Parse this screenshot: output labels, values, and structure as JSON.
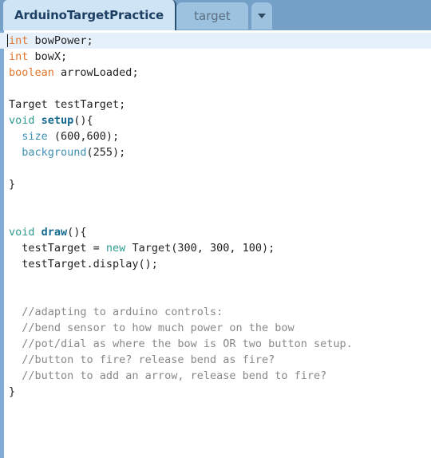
{
  "window": {
    "title": "ArduinoTargetPractice"
  },
  "tabbar": {
    "active_tab": "ArduinoTargetPractice",
    "inactive_tab": "target",
    "menu_icon": "chevron-down-icon",
    "bar_color": "#74a0c8",
    "active_tab_color": "#cfe5f6",
    "inactive_tab_color": "#9cc2e0"
  },
  "editor": {
    "gutter_color": "#7fabd4",
    "highlight_color": "#e5f0fa",
    "background": "#ffffff",
    "cursor_line": 1,
    "colors": {
      "keyword": "#e2762c",
      "type_return": "#2f9b8e",
      "function_name": "#136a91",
      "builtin_function": "#3f8fb5",
      "comment": "#888888",
      "plain": "#222222"
    },
    "lines": [
      {
        "n": 1,
        "tokens": [
          {
            "t": "int",
            "c": "kw"
          },
          {
            "t": " bowPower;",
            "c": "plain"
          }
        ]
      },
      {
        "n": 2,
        "tokens": [
          {
            "t": "int",
            "c": "kw"
          },
          {
            "t": " bowX;",
            "c": "plain"
          }
        ]
      },
      {
        "n": 3,
        "tokens": [
          {
            "t": "boolean",
            "c": "kw"
          },
          {
            "t": " arrowLoaded;",
            "c": "plain"
          }
        ]
      },
      {
        "n": 4,
        "tokens": []
      },
      {
        "n": 5,
        "tokens": [
          {
            "t": "Target testTarget;",
            "c": "plain"
          }
        ]
      },
      {
        "n": 6,
        "tokens": [
          {
            "t": "void",
            "c": "ret"
          },
          {
            "t": " ",
            "c": "plain"
          },
          {
            "t": "setup",
            "c": "fn"
          },
          {
            "t": "(){",
            "c": "plain"
          }
        ]
      },
      {
        "n": 7,
        "tokens": [
          {
            "t": "  ",
            "c": "plain"
          },
          {
            "t": "size",
            "c": "bfn"
          },
          {
            "t": " (600,600);",
            "c": "plain"
          }
        ]
      },
      {
        "n": 8,
        "tokens": [
          {
            "t": "  ",
            "c": "plain"
          },
          {
            "t": "background",
            "c": "bfn"
          },
          {
            "t": "(255);",
            "c": "plain"
          }
        ]
      },
      {
        "n": 9,
        "tokens": []
      },
      {
        "n": 10,
        "tokens": [
          {
            "t": "}",
            "c": "plain"
          }
        ]
      },
      {
        "n": 11,
        "tokens": []
      },
      {
        "n": 12,
        "tokens": []
      },
      {
        "n": 13,
        "tokens": [
          {
            "t": "void",
            "c": "ret"
          },
          {
            "t": " ",
            "c": "plain"
          },
          {
            "t": "draw",
            "c": "fn"
          },
          {
            "t": "(){",
            "c": "plain"
          }
        ]
      },
      {
        "n": 14,
        "tokens": [
          {
            "t": "  testTarget = ",
            "c": "plain"
          },
          {
            "t": "new",
            "c": "ret"
          },
          {
            "t": " Target(300, 300, 100);",
            "c": "plain"
          }
        ]
      },
      {
        "n": 15,
        "tokens": [
          {
            "t": "  testTarget.display();",
            "c": "plain"
          }
        ]
      },
      {
        "n": 16,
        "tokens": []
      },
      {
        "n": 17,
        "tokens": []
      },
      {
        "n": 18,
        "tokens": [
          {
            "t": "  //adapting to arduino controls:",
            "c": "cmt"
          }
        ]
      },
      {
        "n": 19,
        "tokens": [
          {
            "t": "  //bend sensor to how much power on the bow",
            "c": "cmt"
          }
        ]
      },
      {
        "n": 20,
        "tokens": [
          {
            "t": "  //pot/dial as where the bow is OR two button setup.",
            "c": "cmt"
          }
        ]
      },
      {
        "n": 21,
        "tokens": [
          {
            "t": "  //button to fire? release bend as fire?",
            "c": "cmt"
          }
        ]
      },
      {
        "n": 22,
        "tokens": [
          {
            "t": "  //button to add an arrow, release bend to fire?",
            "c": "cmt"
          }
        ]
      },
      {
        "n": 23,
        "tokens": [
          {
            "t": "}",
            "c": "plain"
          }
        ]
      }
    ]
  }
}
